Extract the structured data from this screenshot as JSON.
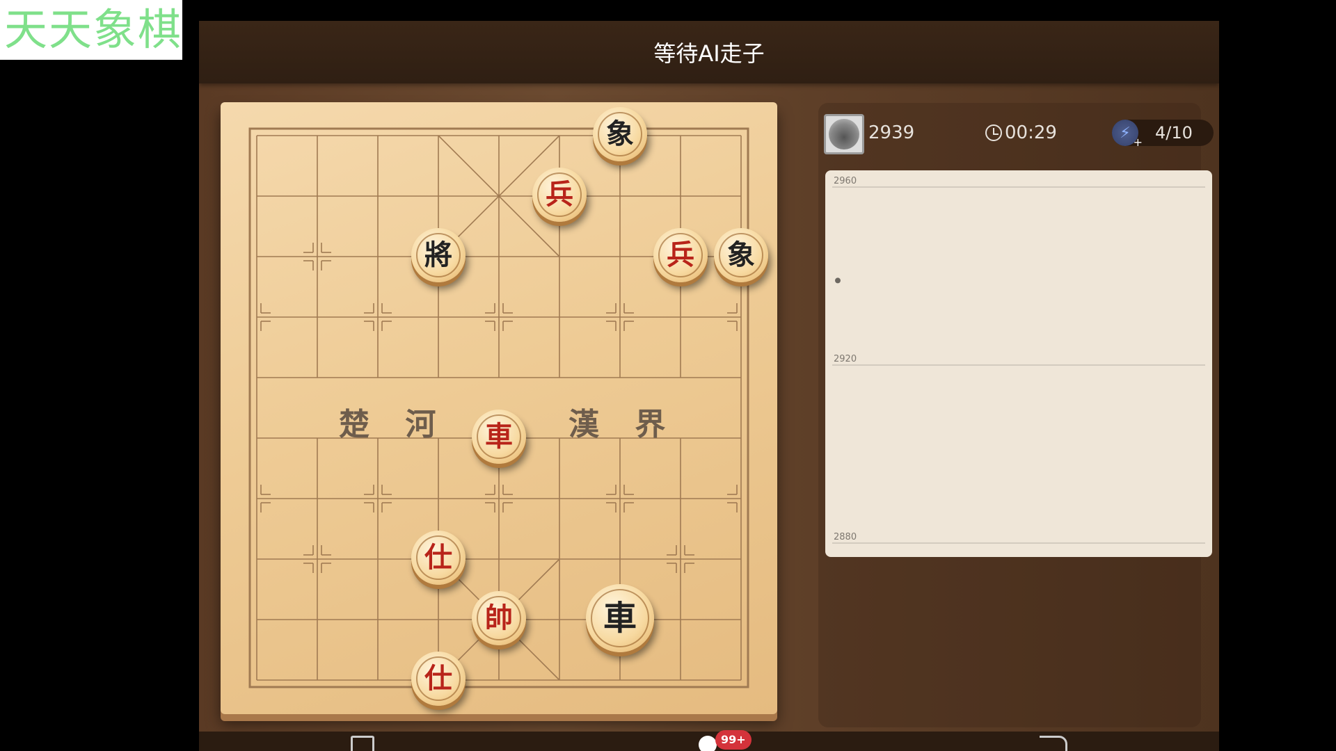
{
  "watermark": "天天象棋",
  "header": {
    "title": "等待AI走子"
  },
  "board": {
    "river_left": "楚 河",
    "river_right": "漢 界",
    "pieces": [
      {
        "glyph": "象",
        "side": "black",
        "file": 6,
        "rank": 0
      },
      {
        "glyph": "兵",
        "side": "red",
        "file": 5,
        "rank": 1
      },
      {
        "glyph": "將",
        "side": "black",
        "file": 3,
        "rank": 2
      },
      {
        "glyph": "兵",
        "side": "red",
        "file": 7,
        "rank": 2
      },
      {
        "glyph": "象",
        "side": "black",
        "file": 8,
        "rank": 2
      },
      {
        "glyph": "車",
        "side": "red",
        "file": 4,
        "rank": 5
      },
      {
        "glyph": "仕",
        "side": "red",
        "file": 3,
        "rank": 7
      },
      {
        "glyph": "帥",
        "side": "red",
        "file": 4,
        "rank": 8
      },
      {
        "glyph": "車",
        "side": "black",
        "file": 6,
        "rank": 8,
        "selected": true
      },
      {
        "glyph": "仕",
        "side": "red",
        "file": 3,
        "rank": 9
      }
    ]
  },
  "opponent": {
    "rating": "2939",
    "timer": "00:29",
    "boost": "4/10"
  },
  "chart_data": {
    "type": "line",
    "title": "",
    "xlabel": "",
    "ylabel": "",
    "yticks": [
      "2960",
      "2920",
      "2880"
    ],
    "ylim": [
      2880,
      2960
    ],
    "series": [
      {
        "values": [
          2939
        ]
      }
    ]
  },
  "footer": {
    "badge": "99+"
  }
}
